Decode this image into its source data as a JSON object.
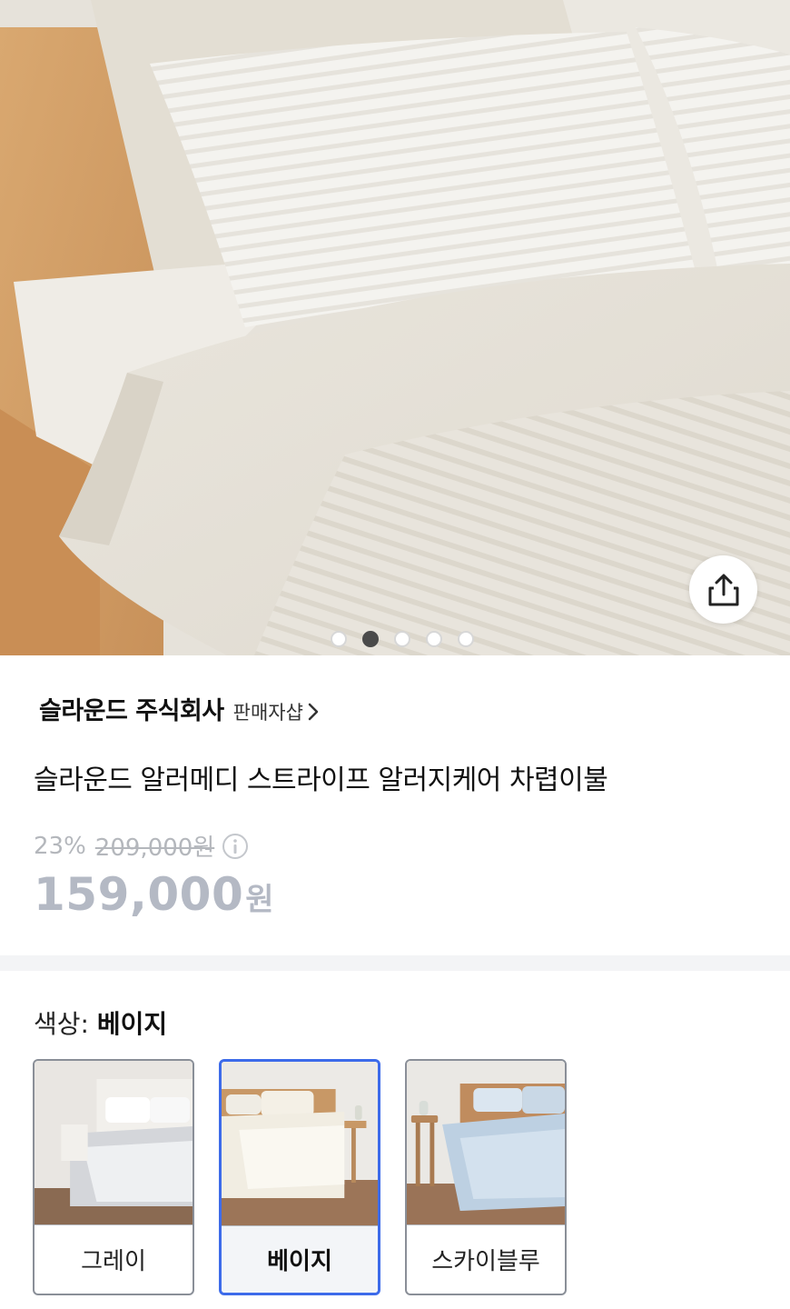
{
  "hero": {
    "image_alt_icon": "bedding-photo",
    "share_icon": "share-icon",
    "carousel": {
      "total": 5,
      "active_index": 1
    }
  },
  "seller": {
    "name": "슬라운드 주식회사",
    "shop_link": "판매자샵"
  },
  "product": {
    "title": "슬라운드 알러메디 스트라이프 알러지케어 차렵이불",
    "discount": "23%",
    "original_price": "209,000원",
    "sale_price_number": "159,000",
    "sale_price_unit": "원"
  },
  "color_option": {
    "label_prefix": "색상: ",
    "selected_value": "베이지",
    "options": [
      {
        "label": "그레이",
        "selected": false
      },
      {
        "label": "베이지",
        "selected": true
      },
      {
        "label": "스카이블루",
        "selected": false
      }
    ]
  },
  "colors": {
    "accent_selected": "#3d6bea",
    "price_muted": "#b4b9c4"
  }
}
